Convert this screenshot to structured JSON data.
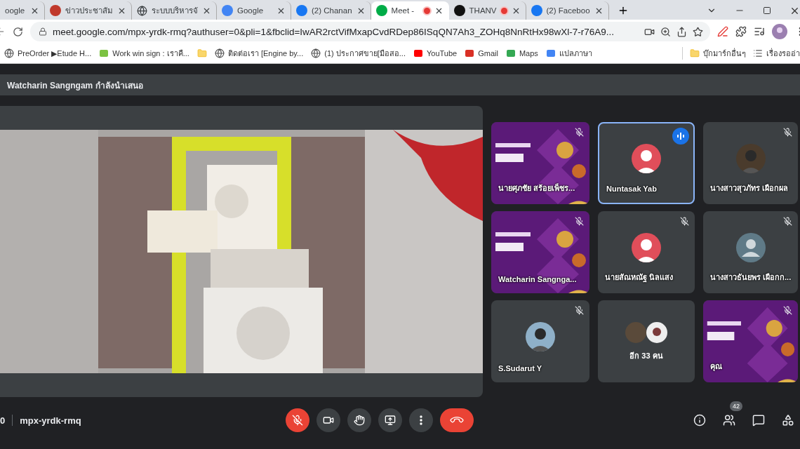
{
  "browser": {
    "tabs": [
      {
        "title": "oogle",
        "selected": false,
        "recording": false
      },
      {
        "title": "ข่าวประชาสัม",
        "selected": false,
        "recording": false
      },
      {
        "title": "ระบบบริหารจั",
        "selected": false,
        "recording": false
      },
      {
        "title": "Google",
        "selected": false,
        "recording": false
      },
      {
        "title": "(2) Chanan",
        "selected": false,
        "recording": false
      },
      {
        "title": "Meet -",
        "selected": true,
        "recording": true
      },
      {
        "title": "THANV",
        "selected": false,
        "recording": true
      },
      {
        "title": "(2) Faceboo",
        "selected": false,
        "recording": false
      }
    ],
    "url": "meet.google.com/mpx-yrdk-rmq?authuser=0&pli=1&fbclid=IwAR2rctVifMxapCvdRDep86ISqQN7Ah3_ZOHq8NnRtHx98wXl-7-r76A9...",
    "bookmarks": [
      {
        "kind": "link",
        "label": "PreOrder ▶Etude H..."
      },
      {
        "kind": "link",
        "label": "Work win sign : เราคื..."
      },
      {
        "kind": "folder"
      },
      {
        "kind": "link",
        "label": "ติดต่อเรา [Engine by..."
      },
      {
        "kind": "link",
        "label": "(1) ประกาศขาย[มือสอ..."
      },
      {
        "kind": "link",
        "label": "YouTube"
      },
      {
        "kind": "link",
        "label": "Gmail"
      },
      {
        "kind": "link",
        "label": "Maps"
      },
      {
        "kind": "link",
        "label": "แปลภาษา"
      }
    ],
    "bookmarks_right": [
      {
        "label": "บุ๊กมาร์กอื่นๆ"
      },
      {
        "label": "เรื่องรออ่า"
      }
    ]
  },
  "meet": {
    "presenter_banner": "Watcharin Sangngam กำลังนำเสนอ",
    "tiles": [
      {
        "kind": "video",
        "name": "นายศุภชัย สร้อยเพ็ชร...",
        "muted": true,
        "speaking": false
      },
      {
        "name": "Nuntasak Yab",
        "muted": false,
        "speaking": true
      },
      {
        "name": "นางสาวสุวภัทร เผือกผล",
        "muted": true,
        "speaking": false
      },
      {
        "kind": "video",
        "name": "Watcharin Sangnga...",
        "muted": true,
        "speaking": false
      },
      {
        "name": "นายสัณหณัฐ นิลแสง",
        "muted": true,
        "speaking": false
      },
      {
        "kind": "generic",
        "name": "นางสาวธันยพร เผือกก...",
        "muted": true,
        "speaking": false
      },
      {
        "name": "S.Sudarut Y",
        "muted": true,
        "speaking": false
      },
      {
        "kind": "more",
        "name": "อีก 33 คน"
      },
      {
        "kind": "video",
        "name": "คุณ",
        "muted": true,
        "speaking": false
      }
    ],
    "time": "0",
    "meeting_code": "mpx-yrdk-rmq",
    "mic_muted": true,
    "people_count": "42"
  }
}
